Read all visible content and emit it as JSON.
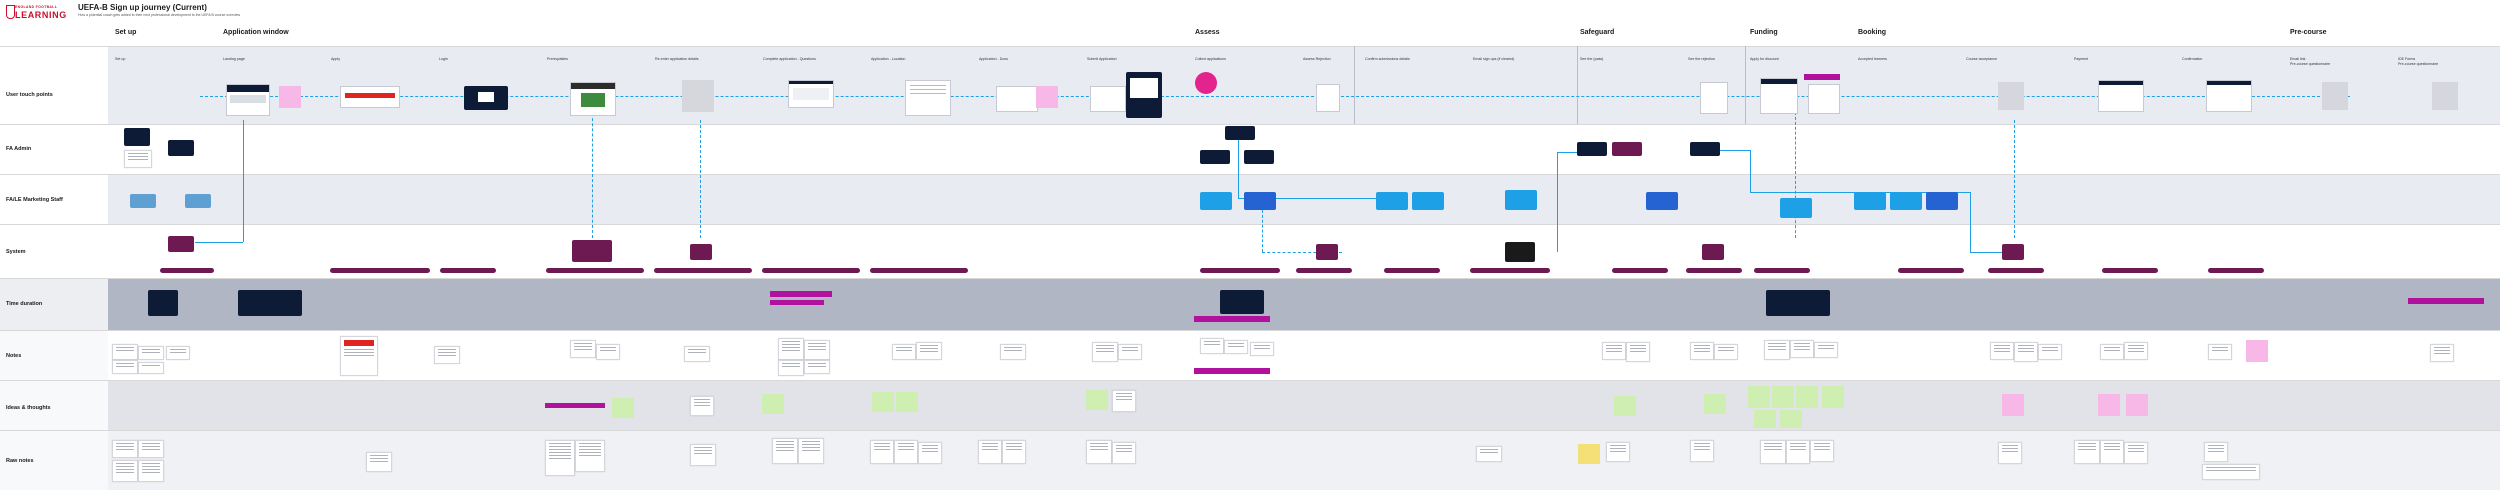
{
  "header": {
    "brand_top": "ENGLAND FOOTBALL",
    "brand_main": "LEARNING",
    "title": "UEFA-B Sign up journey (Current)",
    "subtitle": "How a potential coach gets added to their next professional development to the UEFA B course overview"
  },
  "stages": [
    "Set up",
    "Application window",
    "Assess",
    "Safeguard",
    "Funding",
    "Booking",
    "Pre-course"
  ],
  "steps": [
    "Set up",
    "Landing page",
    "Apply",
    "Login",
    "Prerequisites",
    "Re-enter application details",
    "Complete application - Questions",
    "Application - Location",
    "Application - Docs",
    "Submit Application",
    "Collect applications",
    "Assess Rejection",
    "Confirm submissions details",
    "Email sign ups (if cleared)",
    "See the (pass)",
    "See the rejection",
    "Apply for discount",
    "Accepted learners",
    "Course acceptance",
    "Payment",
    "Confirmation",
    "Email link",
    "IDE Forms"
  ],
  "pre_course_lines": [
    "Pre-course questionnaire",
    "Pre-course questionnaire"
  ],
  "rows": [
    "User touch points",
    "FA Admin",
    "FA/LE Marketing Staff",
    "System",
    "Time duration",
    "Notes",
    "Ideas & thoughts",
    "Raw notes"
  ],
  "colors": {
    "brand_red": "#c8102e",
    "navy": "#0d1b36",
    "plum": "#6e1a52",
    "cyan": "#1ea0e6",
    "blue": "#2463d1",
    "magenta": "#b0119d",
    "sticky_green": "#cfeeb2",
    "sticky_pink": "#f7b8e8",
    "sticky_yellow": "#f5df77",
    "lane_light": "#e8ebf2",
    "lane_dark": "#b0b6c4"
  }
}
